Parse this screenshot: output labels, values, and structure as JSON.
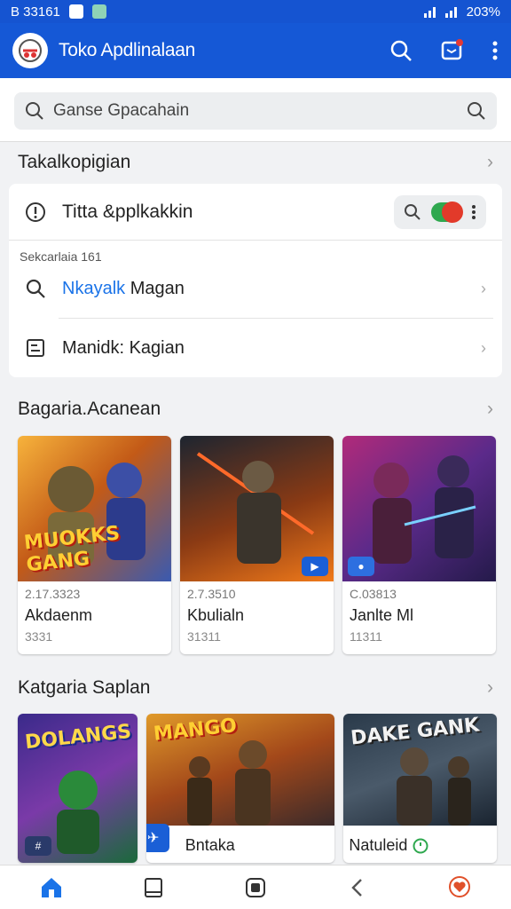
{
  "status_bar": {
    "time": "B 33161",
    "battery": "203%"
  },
  "app_bar": {
    "title": "Toko Apdlinalaan"
  },
  "search": {
    "placeholder": "Ganse Gpacahain"
  },
  "section1": {
    "title": "Takalkopigian"
  },
  "card1": {
    "top_row": "Titta &pplkakkin",
    "sublabel": "Sekcarlaia 161",
    "row1_highlight": "Nkayalk",
    "row1_rest": " Magan",
    "row2": "Manidk: Kagian"
  },
  "section2": {
    "title": "Bagaria.Acanean",
    "tiles": [
      {
        "art_text": "MUOKKS GANG",
        "meta1": "2.17.3323",
        "name": "Akdaenm",
        "meta2": "3331"
      },
      {
        "art_text": "",
        "meta1": "2.7.3510",
        "name": "Kbulialn",
        "meta2": "31311"
      },
      {
        "art_text": "",
        "meta1": "C.03813",
        "name": "Janlte Ml",
        "meta2": "11311"
      }
    ]
  },
  "section3": {
    "title": "Katgaria Saplan",
    "tiles": [
      {
        "art_text": "DOLANGS",
        "name": ""
      },
      {
        "art_text": "MANGO",
        "name": "Bntaka"
      },
      {
        "art_text": "DAKE GANK",
        "name": "Natuleid"
      }
    ]
  },
  "icons": {
    "search": "search-icon",
    "inbox": "inbox-icon",
    "more": "more-vertical-icon",
    "home": "home-icon",
    "back": "back-icon"
  },
  "colors": {
    "primary": "#1558d6",
    "accent": "#1a73e8",
    "toggle_on": "#2fa84f",
    "toggle_knob": "#e23a2a"
  }
}
